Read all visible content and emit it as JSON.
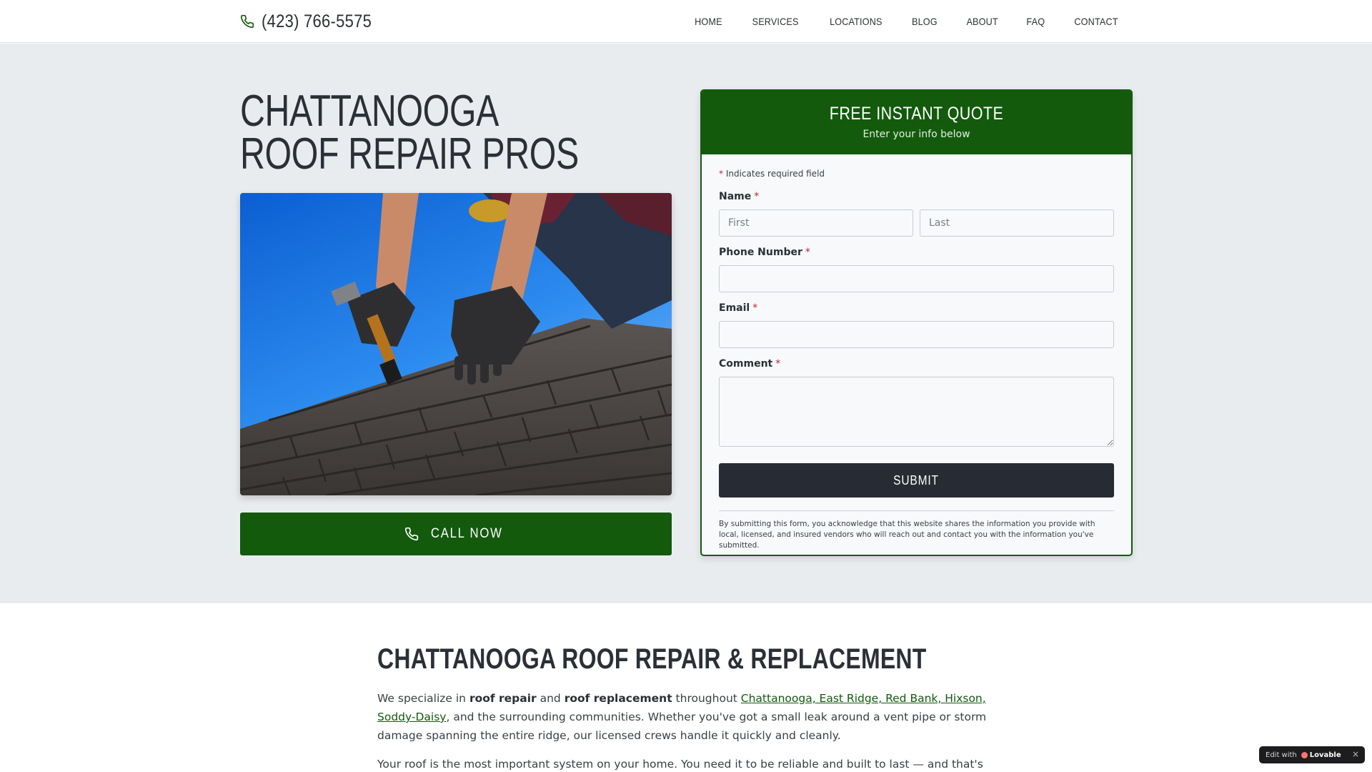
{
  "header": {
    "phone": "(423) 766-5575",
    "nav": [
      "HOME",
      "SERVICES",
      "LOCATIONS",
      "BLOG",
      "ABOUT",
      "FAQ",
      "CONTACT"
    ]
  },
  "hero": {
    "title_line1": "CHATTANOOGA",
    "title_line2": "ROOF REPAIR PROS",
    "image_icon": "roofer-hammering-shingles-photo",
    "call_label": "CALL NOW"
  },
  "quote": {
    "title": "FREE INSTANT QUOTE",
    "subtitle": "Enter your info below",
    "required_asterisk": "*",
    "required_note": "Indicates required field",
    "name_label": "Name",
    "first_placeholder": "First",
    "last_placeholder": "Last",
    "phone_label": "Phone Number",
    "email_label": "Email",
    "comment_label": "Comment",
    "submit_label": "SUBMIT",
    "disclaimer": "By submitting this form, you acknowledge that this website shares the information you provide with local, licensed, and insured vendors who will reach out and contact you with the information you've submitted."
  },
  "content": {
    "section_title": "CHATTANOOGA ROOF REPAIR & REPLACEMENT",
    "p1_a": "We specialize in ",
    "p1_b": "roof repair",
    "p1_c": " and ",
    "p1_d": "roof replacement",
    "p1_e": " throughout ",
    "p1_link": "Chattanooga, East Ridge, Red Bank, Hixson, Soddy-Daisy",
    "p1_f": ", and the surrounding communities. Whether you've got a small leak around a vent pipe or storm damage spanning the entire ridge, our licensed crews handle it quickly and cleanly.",
    "p2": "Your roof is the most important system on your home. You need it to be reliable and built to last — and that's"
  },
  "badge": {
    "edit_with": "Edit with",
    "brand": "Lovable",
    "close": "×"
  },
  "colors": {
    "brand_green": "#135a0d",
    "submit_dark": "#272b33",
    "hero_bg": "#e9ecef",
    "required_red": "#c0262d"
  }
}
